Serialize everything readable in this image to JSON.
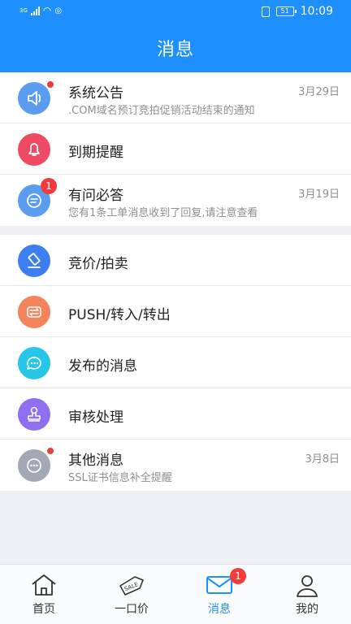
{
  "status_bar": {
    "network": "3G",
    "battery": "51",
    "time": "10:09"
  },
  "header": {
    "title": "消息"
  },
  "groups": [
    {
      "items": [
        {
          "title": "系统公告",
          "subtitle": ".COM域名预订竞拍促销活动结束的通知",
          "date": "3月29日",
          "icon": "speaker-icon",
          "color": "#5a9cf0",
          "badge": "dot"
        },
        {
          "title": "到期提醒",
          "subtitle": "",
          "date": "",
          "icon": "bell-icon",
          "color": "#ee4a64",
          "badge": ""
        },
        {
          "title": "有问必答",
          "subtitle": "您有1条工单消息收到了回复,请注意查看",
          "date": "3月19日",
          "icon": "chat-icon",
          "color": "#5a9cf0",
          "badge": "1"
        }
      ]
    },
    {
      "items": [
        {
          "title": "竞价/拍卖",
          "icon": "gavel-icon",
          "color": "#3d7ff0"
        },
        {
          "title": "PUSH/转入/转出",
          "icon": "transfer-icon",
          "color": "#f4845c"
        },
        {
          "title": "发布的消息",
          "icon": "message-icon",
          "color": "#26c6e9"
        },
        {
          "title": "审核处理",
          "icon": "stamp-icon",
          "color": "#8f6ff0"
        },
        {
          "title": "其他消息",
          "subtitle": "SSL证书信息补全提醒",
          "date": "3月8日",
          "icon": "more-icon",
          "color": "#a3a9b4",
          "badge": "small-dot"
        }
      ]
    }
  ],
  "tabbar": [
    {
      "label": "首页",
      "icon": "home-icon"
    },
    {
      "label": "一口价",
      "icon": "sale-tag-icon"
    },
    {
      "label": "消息",
      "icon": "mail-icon",
      "badge": "1",
      "active": true
    },
    {
      "label": "我的",
      "icon": "person-icon"
    }
  ],
  "colors": {
    "primary": "#1e8fff",
    "badge": "#f23b3b"
  }
}
